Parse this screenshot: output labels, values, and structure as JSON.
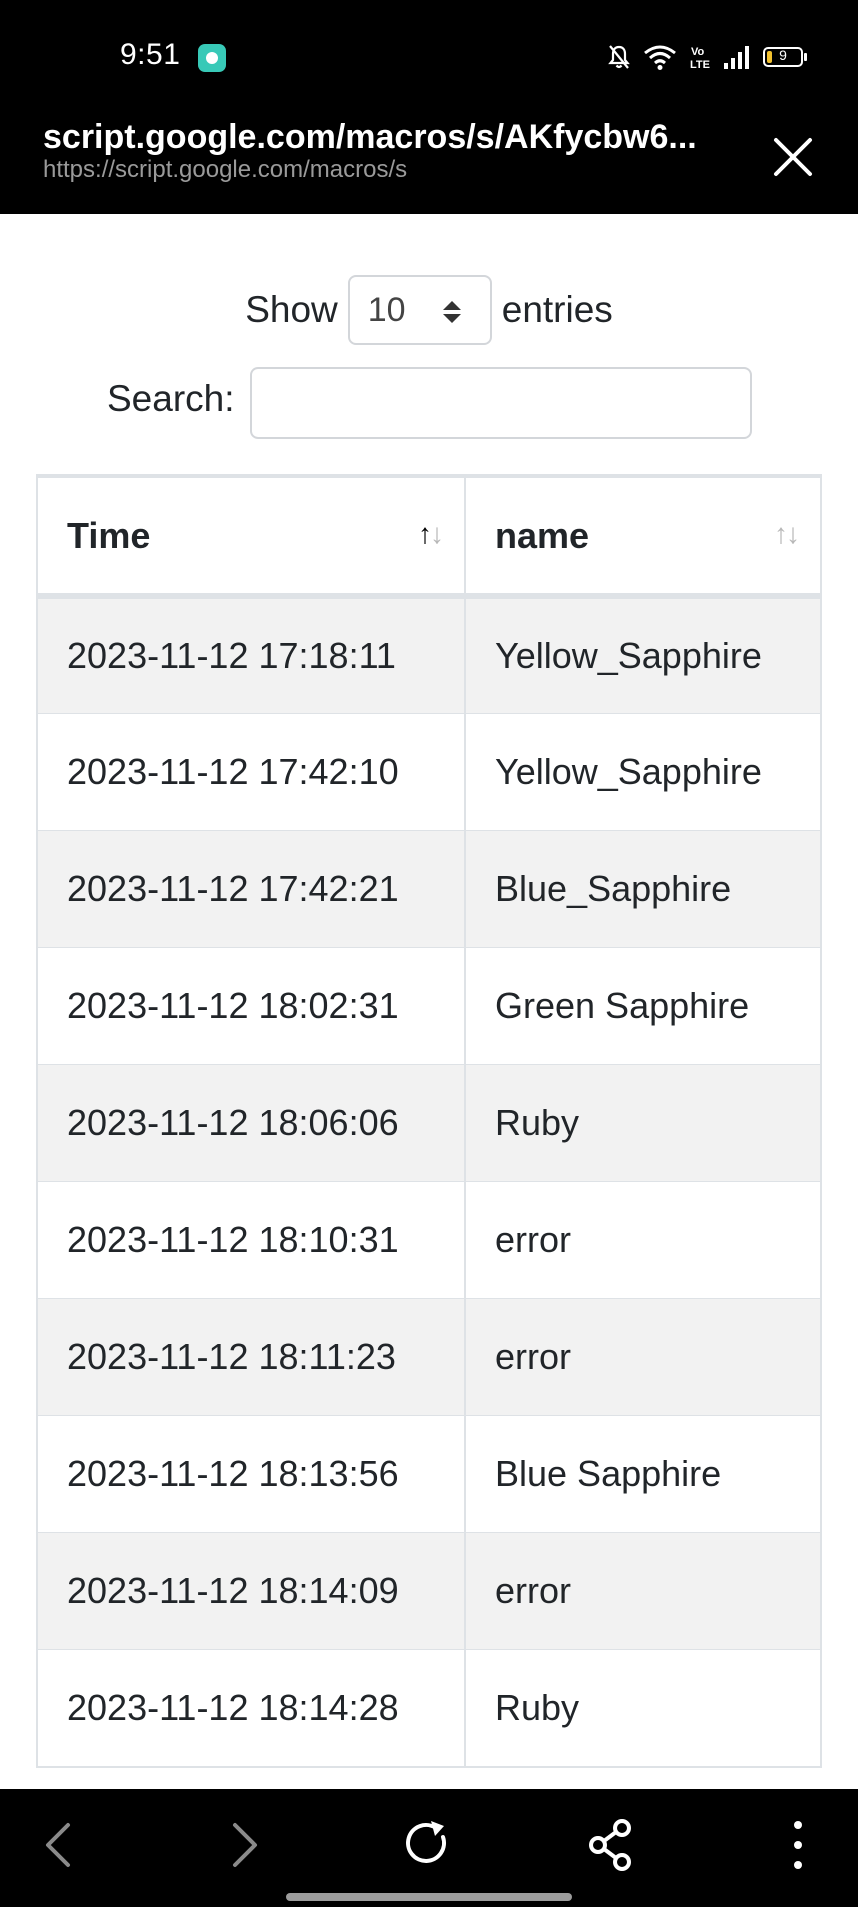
{
  "status_bar": {
    "time": "9:51",
    "battery_level": "9",
    "icons": [
      "app-notification-icon",
      "bell-muted-icon",
      "wifi-icon",
      "volte-icon",
      "signal-icon",
      "battery-icon"
    ]
  },
  "browser": {
    "page_title": "script.google.com/macros/s/AKfycbw6...",
    "url": "https://script.google.com/macros/s",
    "close_icon": "close-icon"
  },
  "controls": {
    "show_label": "Show",
    "entries_label": "entries",
    "page_length": "10",
    "search_label": "Search:",
    "search_value": ""
  },
  "table": {
    "columns": [
      {
        "label": "Time",
        "sort": "ascending"
      },
      {
        "label": "name",
        "sort": "none"
      }
    ],
    "rows": [
      {
        "time": "2023-11-12 17:18:11",
        "name": "Yellow_Sapphire"
      },
      {
        "time": "2023-11-12 17:42:10",
        "name": "Yellow_Sapphire"
      },
      {
        "time": "2023-11-12 17:42:21",
        "name": "Blue_Sapphire"
      },
      {
        "time": "2023-11-12 18:02:31",
        "name": "Green Sapphire"
      },
      {
        "time": "2023-11-12 18:06:06",
        "name": "Ruby"
      },
      {
        "time": "2023-11-12 18:10:31",
        "name": "error"
      },
      {
        "time": "2023-11-12 18:11:23",
        "name": "error"
      },
      {
        "time": "2023-11-12 18:13:56",
        "name": "Blue Sapphire"
      },
      {
        "time": "2023-11-12 18:14:09",
        "name": "error"
      },
      {
        "time": "2023-11-12 18:14:28",
        "name": "Ruby"
      }
    ]
  },
  "bottom_nav": {
    "icons": [
      "back-icon",
      "forward-icon",
      "refresh-icon",
      "share-icon",
      "more-icon"
    ]
  },
  "colors": {
    "bar_background": "#000000",
    "row_stripe": "#f2f2f2",
    "border": "#dee2e6",
    "battery_low": "#f2c12e",
    "app_icon": "#38c9b7"
  }
}
